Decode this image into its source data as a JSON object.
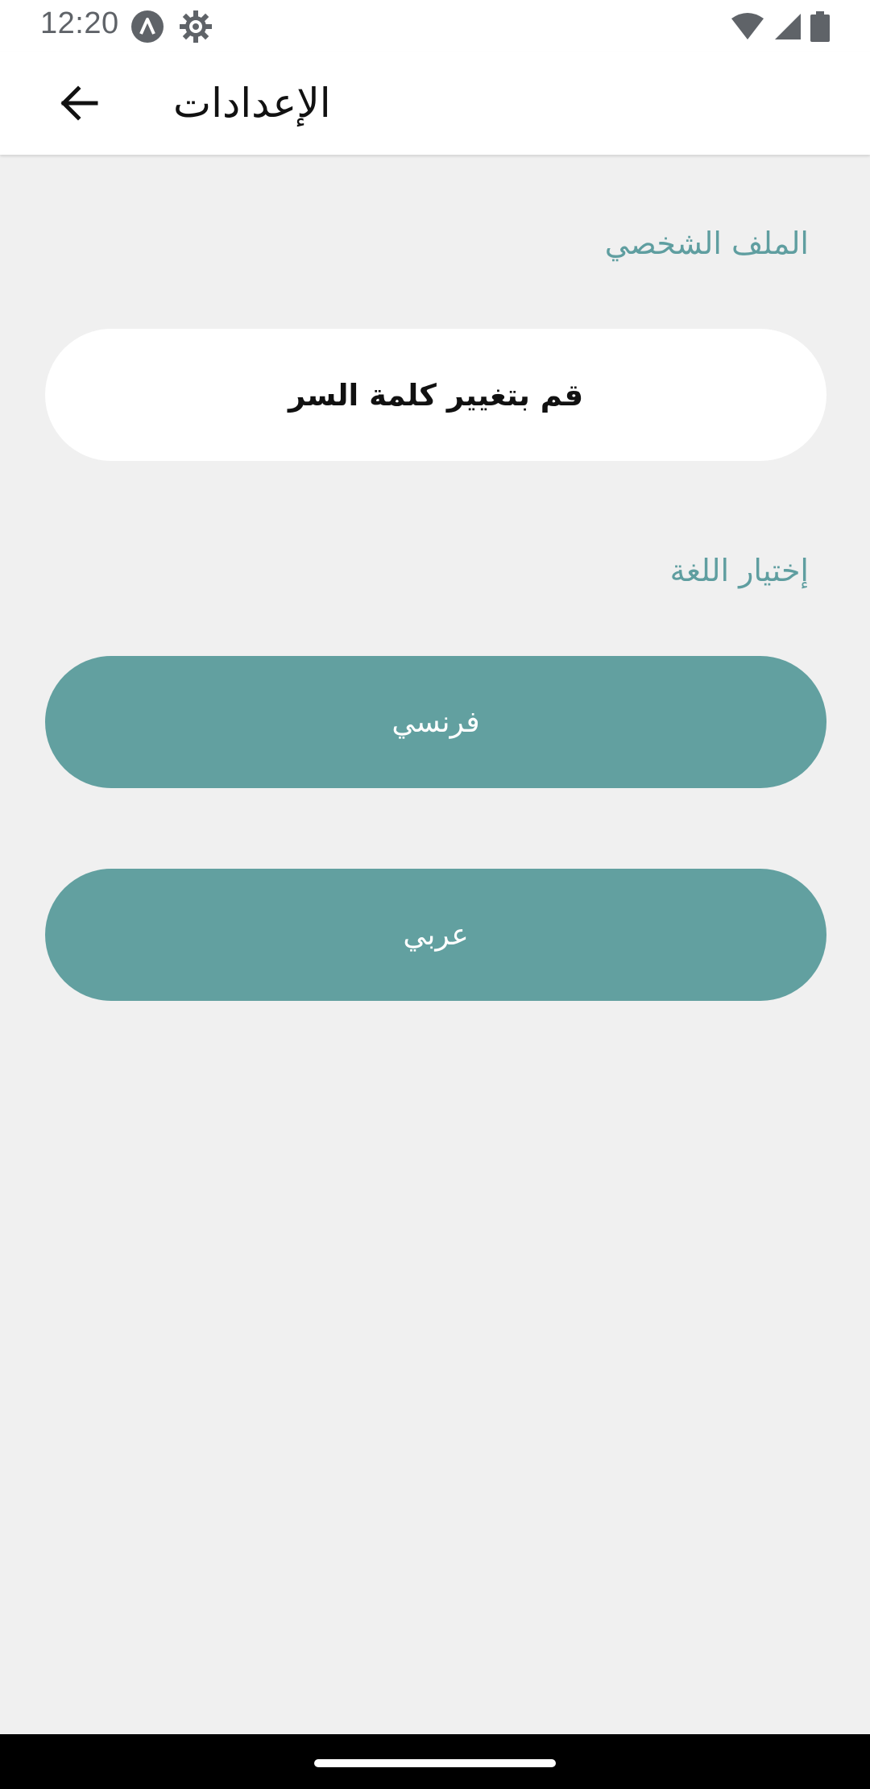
{
  "status_bar": {
    "time": "12:20",
    "left_icons": [
      "a-circle-icon",
      "gear-icon"
    ],
    "right_icons": [
      "wifi-icon",
      "signal-icon",
      "battery-icon"
    ]
  },
  "app_bar": {
    "back_icon": "arrow-back-icon",
    "title": "الإعدادات"
  },
  "profile_section": {
    "header": "الملف الشخصي",
    "change_password_label": "قم بتغيير كلمة السر"
  },
  "language_section": {
    "header": "إختيار اللغة",
    "french_label": "فرنسي",
    "arabic_label": "عربي"
  },
  "colors": {
    "accent": "#62a0a0",
    "section_header": "#5f9ea0",
    "background": "#f0f0f0"
  }
}
